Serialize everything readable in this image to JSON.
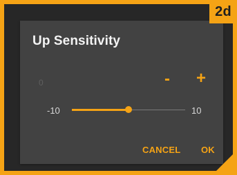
{
  "badge": {
    "label": "2d"
  },
  "dialog": {
    "title": "Up Sensitivity",
    "current_value_text": "0",
    "decrement_label": "-",
    "increment_label": "+",
    "slider": {
      "min_label": "-10",
      "max_label": "10",
      "min": -10,
      "max": 10,
      "value": 0
    },
    "cancel_label": "CANCEL",
    "ok_label": "OK"
  },
  "colors": {
    "accent": "#f5a315",
    "dialog_bg": "#424242",
    "screen_bg": "#272727",
    "text_primary": "#f3f3f3"
  }
}
